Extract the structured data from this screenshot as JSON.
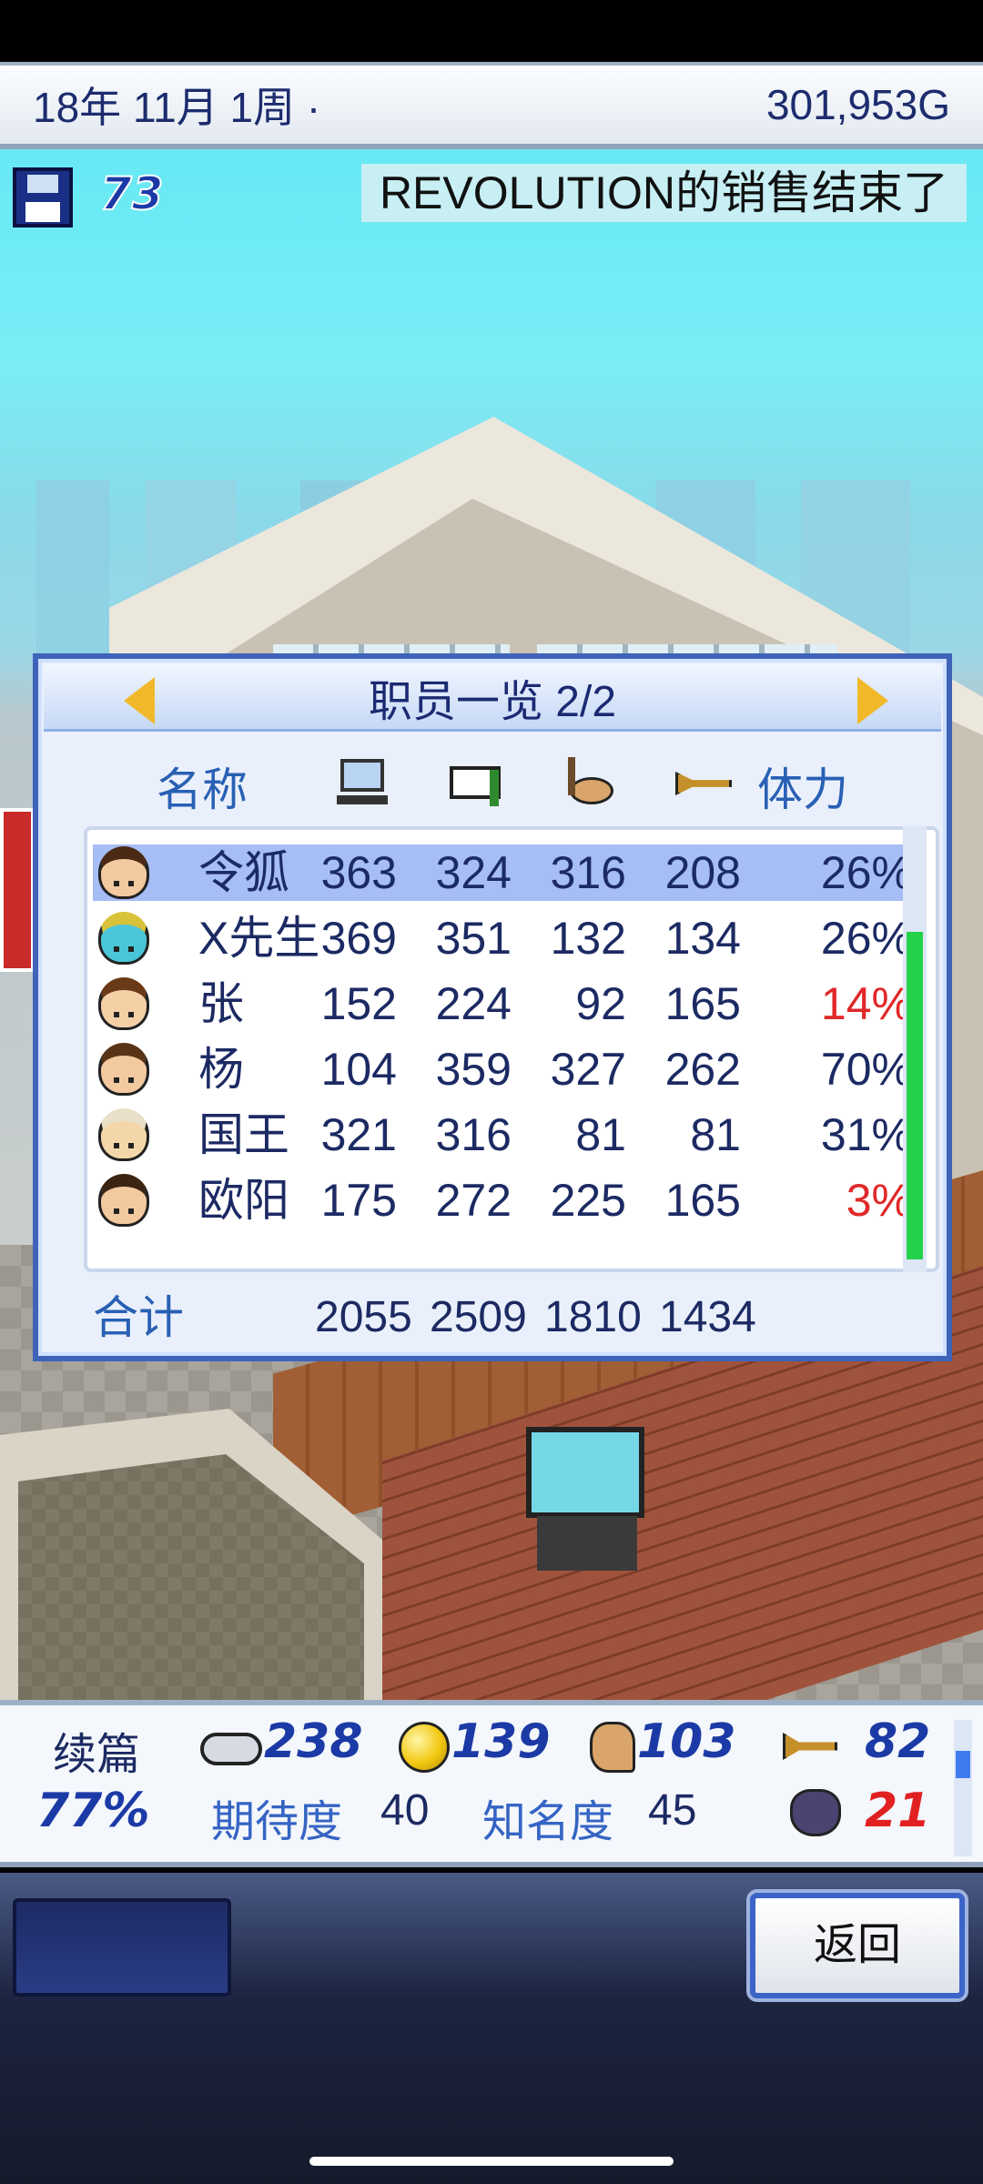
{
  "header": {
    "date": "18年 11月 1周 ·",
    "money": "301,953G"
  },
  "info": {
    "disk_count": "73",
    "news": "REVOLUTION的销售结束了"
  },
  "staff_window": {
    "title": "职员一览 2/2",
    "col_name": "名称",
    "col_stamina": "体力",
    "header_icons": [
      "computer-icon",
      "book-icon",
      "paint-icon",
      "trumpet-icon"
    ],
    "rows": [
      {
        "name": "令狐",
        "v1": "363",
        "v2": "324",
        "v3": "316",
        "v4": "208",
        "stamina": "26%",
        "low": false,
        "selected": true,
        "face_color": "#f3c9a0",
        "hair_color": "#4a2a14"
      },
      {
        "name": "X先生",
        "v1": "369",
        "v2": "351",
        "v3": "132",
        "v4": "134",
        "stamina": "26%",
        "low": false,
        "selected": false,
        "face_color": "#4bc6d9",
        "hair_color": "#d8c23a"
      },
      {
        "name": "张",
        "v1": "152",
        "v2": "224",
        "v3": "92",
        "v4": "165",
        "stamina": "14%",
        "low": true,
        "selected": false,
        "face_color": "#f5cfa6",
        "hair_color": "#6a3a18"
      },
      {
        "name": "杨",
        "v1": "104",
        "v2": "359",
        "v3": "327",
        "v4": "262",
        "stamina": "70%",
        "low": false,
        "selected": false,
        "face_color": "#f3c9a0",
        "hair_color": "#5a3416"
      },
      {
        "name": "国王",
        "v1": "321",
        "v2": "316",
        "v3": "81",
        "v4": "81",
        "stamina": "31%",
        "low": false,
        "selected": false,
        "face_color": "#f3d7a8",
        "hair_color": "#e8e0c8"
      },
      {
        "name": "欧阳",
        "v1": "175",
        "v2": "272",
        "v3": "225",
        "v4": "165",
        "stamina": "3%",
        "low": true,
        "selected": false,
        "face_color": "#f3c9a0",
        "hair_color": "#3a2412"
      }
    ],
    "total_label": "合计",
    "totals": [
      "2055",
      "2509",
      "1810",
      "1434"
    ]
  },
  "game_status": {
    "genre": "续篇",
    "fun": "238",
    "creativity": "139",
    "graphics": "103",
    "sound": "82",
    "progress": "77%",
    "expectation_label": "期待度",
    "expectation": "40",
    "fame_label": "知名度",
    "fame": "45",
    "bugs": "21"
  },
  "controls": {
    "back_label": "返回"
  }
}
